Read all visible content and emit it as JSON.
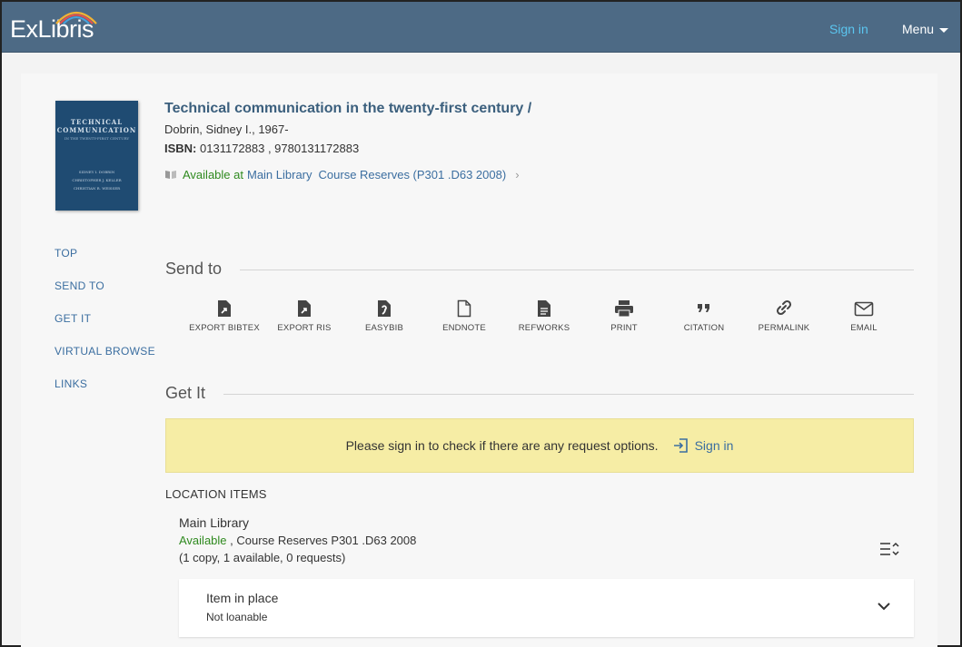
{
  "header": {
    "logo": "ExLibris",
    "sign_in": "Sign in",
    "menu": "Menu"
  },
  "record": {
    "cover": {
      "line1": "TECHNICAL",
      "line2": "COMMUNICATION",
      "subtitle": "IN THE TWENTY-FIRST CENTURY",
      "authors": [
        "SIDNEY I. DOBRIN",
        "CHRISTOPHER J. KELLER",
        "CHRISTIAN R. WEISSER"
      ]
    },
    "title": "Technical communication in the twenty-first century /",
    "author": "Dobrin, Sidney I., 1967-",
    "isbn_label": "ISBN:",
    "isbn_value": " 0131172883 , 9780131172883",
    "availability": {
      "status": "Available at",
      "library": "Main Library",
      "location": "Course Reserves (P301 .D63 2008)"
    }
  },
  "leftnav": [
    "TOP",
    "SEND TO",
    "GET IT",
    "VIRTUAL BROWSE",
    "LINKS"
  ],
  "send_to": {
    "heading": "Send to",
    "actions": [
      {
        "label": "EXPORT BIBTEX",
        "icon": "export-file-icon"
      },
      {
        "label": "EXPORT RIS",
        "icon": "export-file-icon"
      },
      {
        "label": "EASYBIB",
        "icon": "easybib-icon"
      },
      {
        "label": "ENDNOTE",
        "icon": "document-icon"
      },
      {
        "label": "REFWORKS",
        "icon": "document-lines-icon"
      },
      {
        "label": "PRINT",
        "icon": "printer-icon"
      },
      {
        "label": "CITATION",
        "icon": "quote-icon"
      },
      {
        "label": "PERMALINK",
        "icon": "link-icon"
      },
      {
        "label": "EMAIL",
        "icon": "envelope-icon"
      }
    ]
  },
  "get_it": {
    "heading": "Get It",
    "banner_message": "Please sign in to check if there are any request options.",
    "banner_sign_in": "Sign in",
    "location_items_label": "LOCATION ITEMS",
    "library": "Main Library",
    "status": "Available",
    "location_detail": " , Course Reserves P301 .D63 2008",
    "counts": "(1 copy, 1 available, 0 requests)",
    "item": {
      "status": "Item in place",
      "policy": "Not loanable"
    }
  },
  "colors": {
    "header_bg": "#4d6a85",
    "link": "#3b6ea0",
    "available": "#2f8a1f",
    "banner": "#f6eda5"
  }
}
